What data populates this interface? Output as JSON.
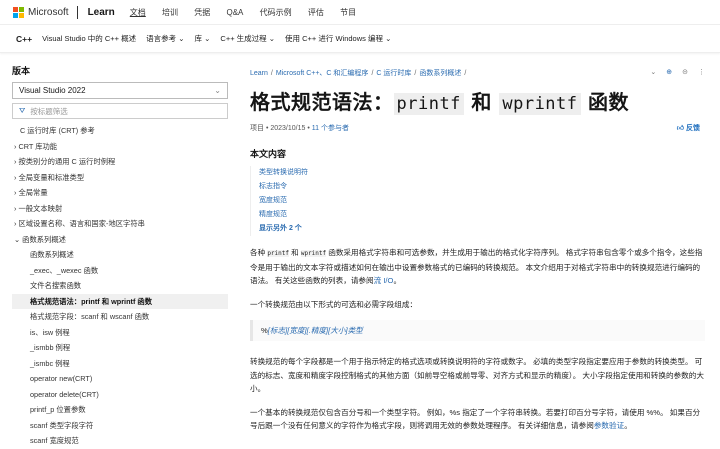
{
  "header": {
    "brand": "Microsoft",
    "product": "Learn",
    "nav": [
      "文档",
      "培训",
      "凭据",
      "Q&A",
      "代码示例",
      "评估",
      "节目"
    ]
  },
  "subnav": {
    "home": "C++",
    "items": [
      "Visual Studio 中的 C++ 概述",
      "语言参考 ⌄",
      "库 ⌄",
      "C++ 生成过程 ⌄",
      "使用 C++ 进行 Windows 编程 ⌄"
    ]
  },
  "sidebar": {
    "version_label": "版本",
    "version_value": "Visual Studio 2022",
    "filter_placeholder": "按标题筛选",
    "items": [
      {
        "label": "C 运行时库 (CRT) 参考",
        "level": 0
      },
      {
        "label": "› CRT 库功能",
        "level": 1
      },
      {
        "label": "› 按类别分的通用 C 运行时例程",
        "level": 1
      },
      {
        "label": "› 全局变量和标准类型",
        "level": 1
      },
      {
        "label": "› 全局常量",
        "level": 1
      },
      {
        "label": "› 一般文本映射",
        "level": 1
      },
      {
        "label": "› 区域设置名称、语言和国家-地区字符串",
        "level": 1
      },
      {
        "label": "⌄ 函数系列概述",
        "level": 1
      },
      {
        "label": "函数系列概述",
        "level": 2
      },
      {
        "label": "_exec、_wexec 函数",
        "level": 2
      },
      {
        "label": "文件名搜索函数",
        "level": 2
      },
      {
        "label": "格式规范语法：printf 和 wprintf 函数",
        "level": 2,
        "active": true
      },
      {
        "label": "格式规范字段：scanf 和 wscanf 函数",
        "level": 2
      },
      {
        "label": "is、isw 例程",
        "level": 2
      },
      {
        "label": "_ismbb 例程",
        "level": 2
      },
      {
        "label": "_ismbc 例程",
        "level": 2
      },
      {
        "label": "operator new(CRT)",
        "level": 2
      },
      {
        "label": "operator delete(CRT)",
        "level": 2
      },
      {
        "label": "printf_p 位置参数",
        "level": 2
      },
      {
        "label": "scanf 类型字段字符",
        "level": 2
      },
      {
        "label": "scanf 宽度规范",
        "level": 2
      }
    ]
  },
  "main": {
    "breadcrumb": [
      "Learn",
      "/",
      "Microsoft C++、C 和汇编程序",
      "/",
      "C 运行时库",
      "/",
      "函数系列概述",
      "/"
    ],
    "title": {
      "a": "格式规范语法：",
      "code1": "printf",
      "b": "和",
      "code2": "wprintf",
      "c": "函数"
    },
    "meta": {
      "type": "项目",
      "date": "2023/10/15",
      "contributors": "11 个参与者",
      "feedback": "反馈"
    },
    "toc_title": "本文内容",
    "toc": [
      "类型转换说明符",
      "标志指令",
      "宽度规范",
      "精度规范"
    ],
    "toc_more": "显示另外 2 个",
    "p1": {
      "a": "各种 ",
      "c1": "printf",
      "b": " 和 ",
      "c2": "wprintf",
      "c": " 函数采用格式字符串和可选参数，并生成用于输出的格式化字符序列。 格式字符串包含零个或多个指令，这些指令是用于输出的文本字符或描述如何在输出中设置参数格式的已编码的转换规范。 本文介绍用于对格式字符串中的转换规范进行编码的语法。 有关这些函数的列表，请参阅",
      "link": "流 I/O",
      "d": "。"
    },
    "p2": "一个转换规范由以下形式的可选和必需字段组成：",
    "syntax": {
      "pct": "%",
      "flags": "[标志]",
      "width": "[宽度]",
      "precision": "[.精度]",
      "size": "[大小]",
      "type": "类型"
    },
    "p3": "转换规范的每个字段都是一个用于指示特定的格式选项或转换说明符的字符或数字。 必填的类型字段指定要应用于参数的转换类型。 可选的标志、宽度和精度字段控制格式的其他方面（如前导空格或前导零、对齐方式和显示的精度）。 大小字段指定使用和转换的参数的大小。",
    "p4": {
      "a": "一个基本的转换规范仅包含百分号和一个类型字符。 例如，%s 指定了一个字符串转换。若要打印百分号字符，请使用 %%。 如果百分号后跟一个没有任何意义的字符作为格式字段，则将调用无效的参数处理程序。 有关详细信息，请参阅",
      "link": "参数验证",
      "b": "。"
    }
  }
}
